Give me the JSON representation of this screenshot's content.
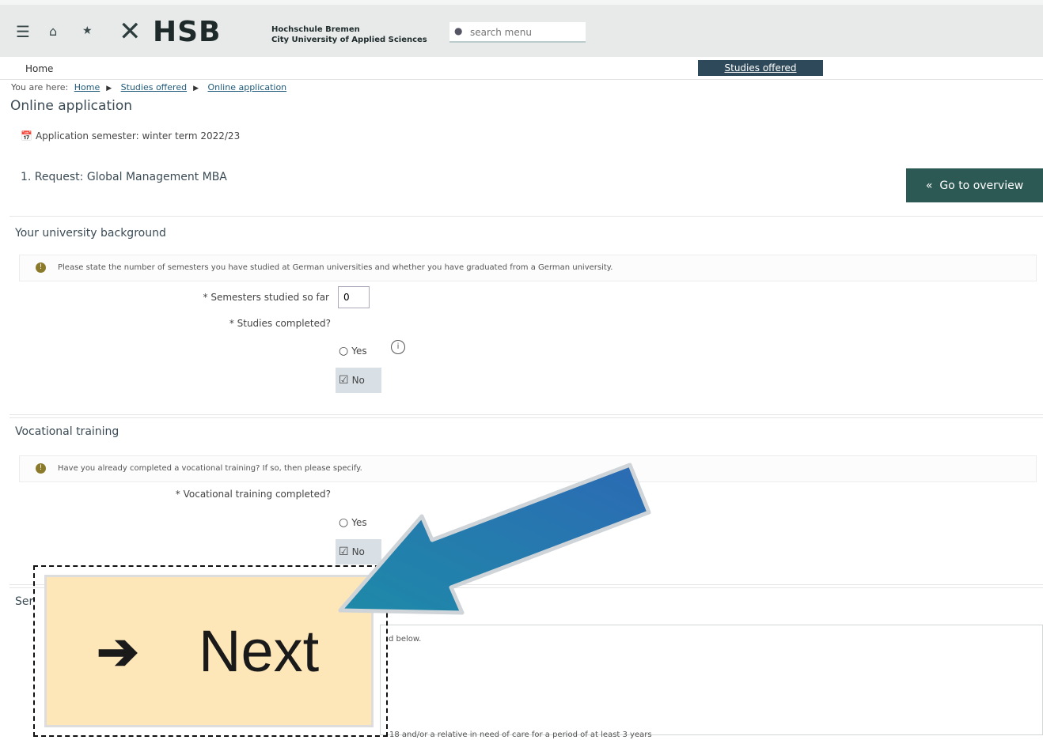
{
  "header": {
    "logo_text": "HSB",
    "uni_line1": "Hochschule Bremen",
    "uni_line2": "City University of Applied Sciences",
    "search_placeholder": "search menu"
  },
  "nav": {
    "home": "Home",
    "active_tab": "Studies offered"
  },
  "breadcrumb": {
    "prefix": "You are here:",
    "items": [
      "Home",
      "Studies offered",
      "Online application"
    ]
  },
  "page": {
    "title": "Online application",
    "semester": "Application semester: winter term 2022/23",
    "request": "1. Request: Global Management MBA",
    "go_overview": "Go to overview"
  },
  "university_background": {
    "title": "Your university background",
    "info": "Please state the number of semesters you have studied at German universities and whether you have graduated from a German university.",
    "semesters_label": "* Semesters studied so far",
    "semesters_value": "0",
    "completed_label": "* Studies completed?",
    "yes": "Yes",
    "no": "No"
  },
  "vocational": {
    "title": "Vocational training",
    "info": "Have you already completed a vocational training? If so, then please specify.",
    "completed_label": "* Vocational training completed?",
    "yes": "Yes",
    "no": "No"
  },
  "third_section": {
    "title_partial": "Ser",
    "text_partial": "d below.",
    "bottom_text_partial": "18 and/or a relative in need of care for a period of at least 3 years"
  },
  "overlay": {
    "next_label": "Next"
  },
  "icons": {
    "menu": "hamburger-icon",
    "home": "home-icon",
    "favorite": "star-icon",
    "search": "search-icon",
    "calendar": "calendar-icon",
    "info": "info-icon",
    "help": "help-icon",
    "next": "arrow-right-icon"
  },
  "colors": {
    "topbar": "#e8eaea",
    "nav_tab": "#2e4a5a",
    "go_button": "#2d5954",
    "next_button": "#fde6b7",
    "pointer_arrow": "#1e8aa8"
  }
}
